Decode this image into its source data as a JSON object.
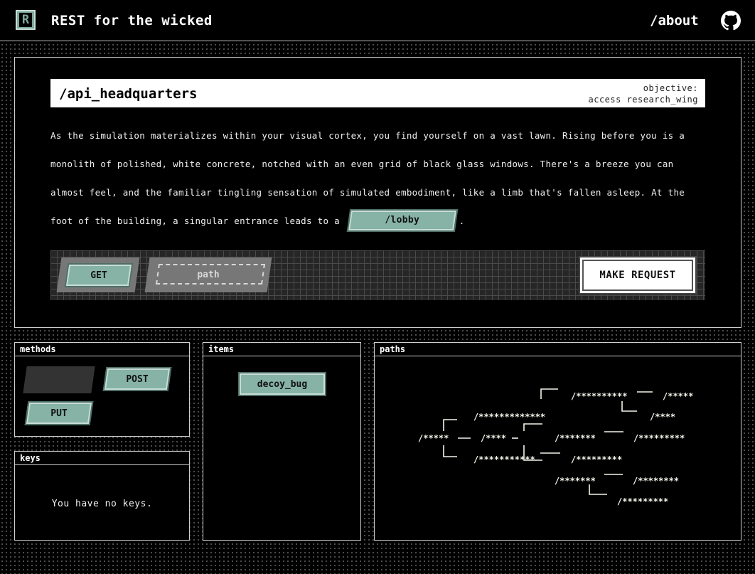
{
  "header": {
    "logo_letter": "R",
    "title": "REST for the wicked",
    "about_label": "/about",
    "github_icon": "github-icon"
  },
  "main": {
    "page_name": "/api_headquarters",
    "objective_label": "objective:",
    "objective_value": "access research_wing",
    "story_before": "As the simulation materializes within your visual cortex, you find yourself on a vast lawn. Rising before you is a monolith of polished, white concrete, notched with an even grid of black glass windows. There's a breeze you can almost feel, and the familiar tingling sensation of simulated embodiment, like a limb that's fallen asleep. At the foot of the building, a singular entrance leads to a",
    "story_link": "/lobby",
    "story_after": "."
  },
  "request": {
    "method": "GET",
    "path_placeholder": "path",
    "submit_label": "MAKE REQUEST"
  },
  "methods": {
    "heading": "methods",
    "items": [
      "POST",
      "PUT"
    ]
  },
  "keys": {
    "heading": "keys",
    "empty_text": "You have no keys."
  },
  "items": {
    "heading": "items",
    "list": [
      "decoy_bug"
    ]
  },
  "paths": {
    "heading": "paths",
    "nodes": [
      "/*****",
      "/****",
      "/*************",
      "/**********",
      "/*****",
      "/****",
      "/***********",
      "/*******",
      "/*********",
      "/*********",
      "/*******",
      "/********",
      "/*********"
    ]
  },
  "colors": {
    "accent": "#86b3a6",
    "background": "#000000",
    "panel_border": "#cfcfcf",
    "path_text": "#f4f4ea"
  }
}
